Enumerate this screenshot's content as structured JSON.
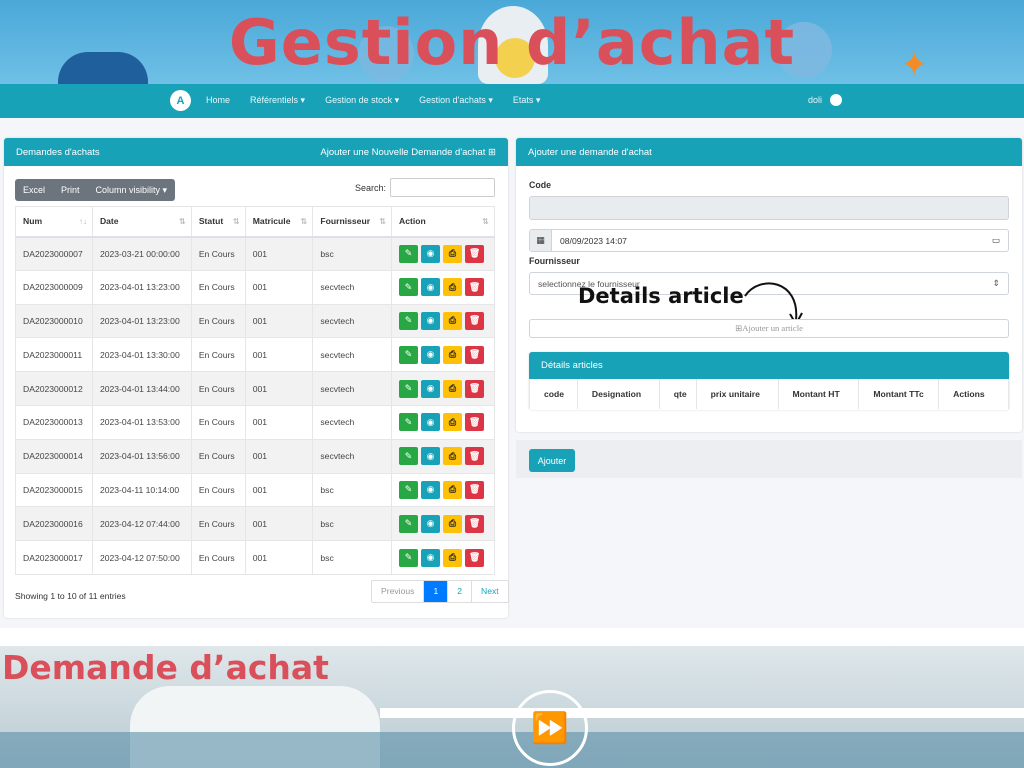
{
  "banner": {
    "title": "Gestion d’achat"
  },
  "navbar": {
    "logo": "A",
    "links": [
      "Home",
      "Référentiels ▾",
      "Gestion de stock ▾",
      "Gestion d'achats ▾",
      "Etats ▾"
    ],
    "user": "doli"
  },
  "list_card": {
    "title": "Demandes d'achats",
    "add_link": "Ajouter une Nouvelle Demande d'achat ⊞",
    "buttons": [
      "Excel",
      "Print",
      "Column visibility ▾"
    ],
    "search_label": "Search:",
    "columns": [
      "Num",
      "Date",
      "Statut",
      "Matricule",
      "Fournisseur",
      "Action"
    ],
    "rows": [
      [
        "DA2023000007",
        "2023-03-21 00:00:00",
        "En Cours",
        "001",
        "bsc"
      ],
      [
        "DA2023000009",
        "2023-04-01 13:23:00",
        "En Cours",
        "001",
        "secvtech"
      ],
      [
        "DA2023000010",
        "2023-04-01 13:23:00",
        "En Cours",
        "001",
        "secvtech"
      ],
      [
        "DA2023000011",
        "2023-04-01 13:30:00",
        "En Cours",
        "001",
        "secvtech"
      ],
      [
        "DA2023000012",
        "2023-04-01 13:44:00",
        "En Cours",
        "001",
        "secvtech"
      ],
      [
        "DA2023000013",
        "2023-04-01 13:53:00",
        "En Cours",
        "001",
        "secvtech"
      ],
      [
        "DA2023000014",
        "2023-04-01 13:56:00",
        "En Cours",
        "001",
        "secvtech"
      ],
      [
        "DA2023000015",
        "2023-04-11 10:14:00",
        "En Cours",
        "001",
        "bsc"
      ],
      [
        "DA2023000016",
        "2023-04-12 07:44:00",
        "En Cours",
        "001",
        "bsc"
      ],
      [
        "DA2023000017",
        "2023-04-12 07:50:00",
        "En Cours",
        "001",
        "bsc"
      ]
    ],
    "showing": "Showing 1 to 10 of 11 entries",
    "pagination": [
      "Previous",
      "1",
      "2",
      "Next"
    ]
  },
  "form_card": {
    "title": "Ajouter une demande d'achat",
    "code_label": "Code",
    "code_value": "",
    "date_value": "08/09/2023 14:07",
    "fournisseur_label": "Fournisseur",
    "fournisseur_placeholder": "selectionnez le fournisseur",
    "add_article": "⊞Ajouter un article",
    "annotation": "Details article",
    "details_title": "Détails articles",
    "details_columns": [
      "code",
      "Designation",
      "qte",
      "prix unitaire",
      "Montant HT",
      "Montant TTc",
      "Actions"
    ],
    "submit": "Ajouter"
  },
  "bottom": {
    "title": "Demande d’achat"
  }
}
